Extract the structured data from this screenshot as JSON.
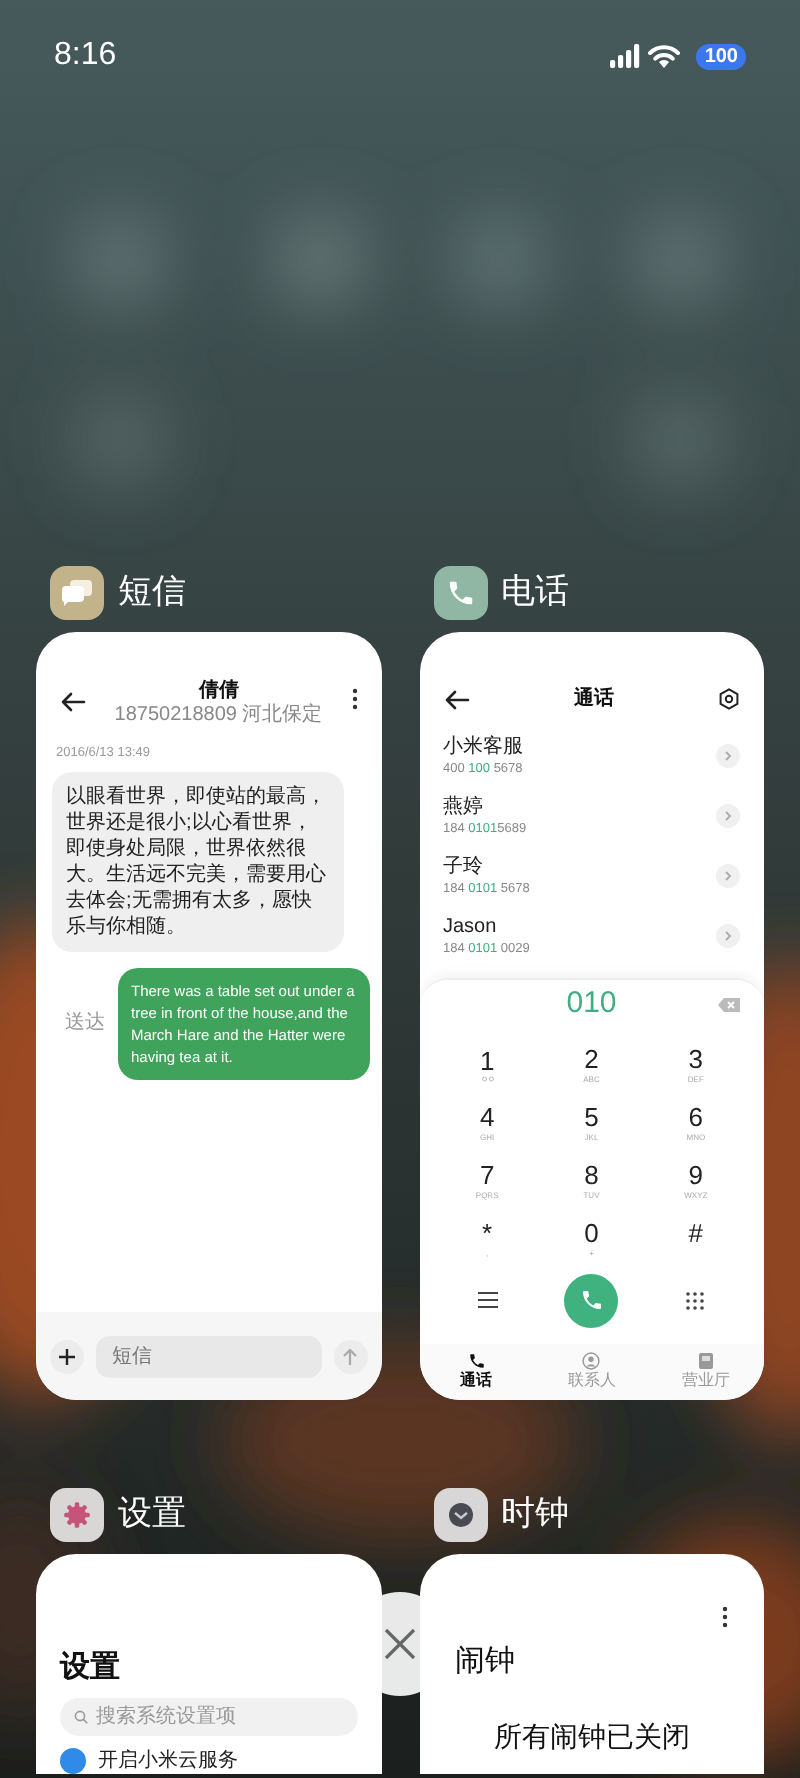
{
  "status_bar": {
    "time": "8:16",
    "battery": "100"
  },
  "apps": [
    {
      "kind": "messages",
      "name": "短信",
      "screen": {
        "contact": "倩倩",
        "subtitle": "18750218809 河北保定",
        "date": "2016/6/13 13:49",
        "messages": [
          {
            "kind": "received",
            "text": "以眼看世界，即使站的最高，世界还是很小;以心看世界，即使身处局限，世界依然很大。生活远不完美，需要用心去体会;无需拥有太多，愿快乐与你相随。"
          },
          {
            "kind": "sent",
            "status": "送达",
            "text": "There was a table set out under a tree in front of the house,and the March Hare and the Hatter were having tea at it."
          }
        ],
        "input_placeholder": "短信"
      }
    },
    {
      "kind": "phone",
      "name": "电话",
      "screen": {
        "title": "通话",
        "contacts": [
          {
            "name": "小米客服",
            "number_parts": [
              {
                "text": "400 ",
                "match": false
              },
              {
                "text": "100",
                "match": true
              },
              {
                "text": " 5678",
                "match": false
              }
            ]
          },
          {
            "name": "燕婷",
            "number_parts": [
              {
                "text": "184 ",
                "match": false
              },
              {
                "text": "0101",
                "match": true
              },
              {
                "text": "5689",
                "match": false
              }
            ]
          },
          {
            "name": "子玲",
            "number_parts": [
              {
                "text": "184 ",
                "match": false
              },
              {
                "text": "0101",
                "match": true
              },
              {
                "text": " 5678",
                "match": false
              }
            ]
          },
          {
            "name": "Jason",
            "number_parts": [
              {
                "text": "184 ",
                "match": false
              },
              {
                "text": "0101",
                "match": true
              },
              {
                "text": " 0029",
                "match": false
              }
            ]
          }
        ],
        "dialed": "010",
        "keys": [
          {
            "digit": "1",
            "kind": "voicemail"
          },
          {
            "digit": "2",
            "letters": "ABC"
          },
          {
            "digit": "3",
            "letters": "DEF"
          },
          {
            "digit": "4",
            "letters": "GHI"
          },
          {
            "digit": "5",
            "letters": "JKL"
          },
          {
            "digit": "6",
            "letters": "MNO"
          },
          {
            "digit": "7",
            "letters": "PQRS"
          },
          {
            "digit": "8",
            "letters": "TUV"
          },
          {
            "digit": "9",
            "letters": "WXYZ"
          },
          {
            "digit": "*",
            "letters": ","
          },
          {
            "digit": "0",
            "letters": "+"
          },
          {
            "digit": "#"
          }
        ],
        "tabs": [
          {
            "label": "通话",
            "kind": "calls",
            "selected": true
          },
          {
            "label": "联系人",
            "kind": "contacts",
            "selected": false
          },
          {
            "label": "营业厅",
            "kind": "store",
            "selected": false
          }
        ]
      }
    },
    {
      "kind": "settings",
      "name": "设置",
      "screen": {
        "title": "设置",
        "search_placeholder": "搜索系统设置项",
        "first_item": "开启小米云服务"
      }
    },
    {
      "kind": "clock",
      "name": "时钟",
      "screen": {
        "title": "闹钟",
        "empty_message": "所有闹钟已关闭"
      }
    }
  ]
}
